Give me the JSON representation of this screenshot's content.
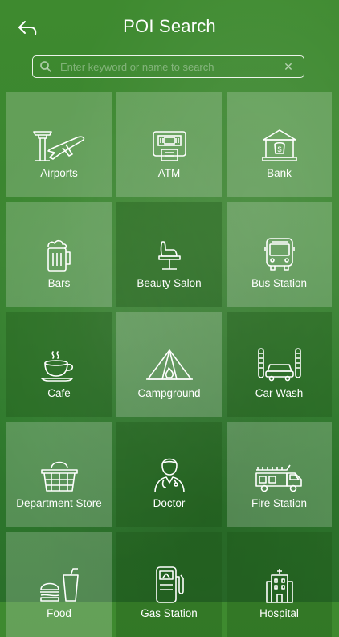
{
  "header": {
    "title": "POI Search"
  },
  "search": {
    "placeholder": "Enter keyword or name to search",
    "clear": "✕"
  },
  "categories": [
    {
      "label": "Airports"
    },
    {
      "label": "ATM"
    },
    {
      "label": "Bank"
    },
    {
      "label": "Bars"
    },
    {
      "label": "Beauty Salon"
    },
    {
      "label": "Bus Station"
    },
    {
      "label": "Cafe"
    },
    {
      "label": "Campground"
    },
    {
      "label": "Car Wash"
    },
    {
      "label": "Department Store"
    },
    {
      "label": "Doctor"
    },
    {
      "label": "Fire Station"
    },
    {
      "label": "Food"
    },
    {
      "label": "Gas Station"
    },
    {
      "label": "Hospital"
    }
  ]
}
